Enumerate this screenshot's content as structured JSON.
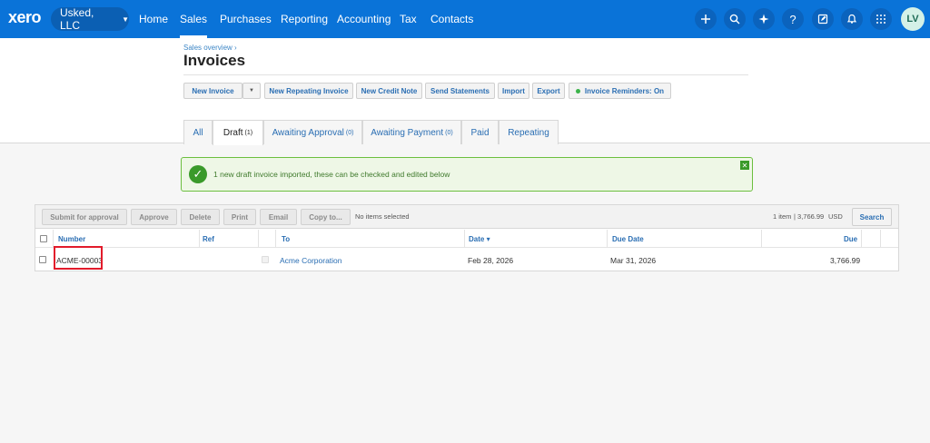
{
  "topbar": {
    "logo": "xero",
    "org_name": "Usked, LLC",
    "nav": [
      "Home",
      "Sales",
      "Purchases",
      "Reporting",
      "Accounting",
      "Tax",
      "Contacts"
    ],
    "active_nav": "Sales",
    "icons": [
      "plus-icon",
      "search-icon",
      "sparkle-icon",
      "help-icon",
      "edit-icon",
      "bell-icon",
      "apps-grid-icon"
    ],
    "avatar_initials": "LV",
    "color": "#0a73d8"
  },
  "header": {
    "breadcrumb": "Sales overview ›",
    "title": "Invoices"
  },
  "actions": {
    "new_invoice": "New Invoice",
    "new_repeating": "New Repeating Invoice",
    "new_credit_note": "New Credit Note",
    "send_statements": "Send Statements",
    "import": "Import",
    "export": "Export",
    "reminders": "Invoice Reminders: On"
  },
  "tabs": [
    {
      "label": "All",
      "count": ""
    },
    {
      "label": "Draft",
      "count": "(1)"
    },
    {
      "label": "Awaiting Approval",
      "count": "(0)"
    },
    {
      "label": "Awaiting Payment",
      "count": "(0)"
    },
    {
      "label": "Paid",
      "count": ""
    },
    {
      "label": "Repeating",
      "count": ""
    }
  ],
  "active_tab": "Draft",
  "notice": {
    "text": "1 new draft invoice imported, these can be checked and edited below",
    "color": "#6cbf3f"
  },
  "toolbar": {
    "submit": "Submit for approval",
    "approve": "Approve",
    "delete": "Delete",
    "print": "Print",
    "email": "Email",
    "copy": "Copy to...",
    "selection_status": "No items selected",
    "summary_count": "1 item",
    "summary_total": "| 3,766.99",
    "summary_currency": "USD",
    "search": "Search"
  },
  "table": {
    "columns": [
      "Number",
      "Ref",
      "To",
      "Date ▾",
      "Due Date",
      "Due"
    ],
    "rows": [
      {
        "number": "ACME-00003",
        "ref": "",
        "to": "Acme Corporation",
        "date": "Feb 28, 2026",
        "due_date": "Mar 31, 2026",
        "due": "3,766.99"
      }
    ]
  }
}
